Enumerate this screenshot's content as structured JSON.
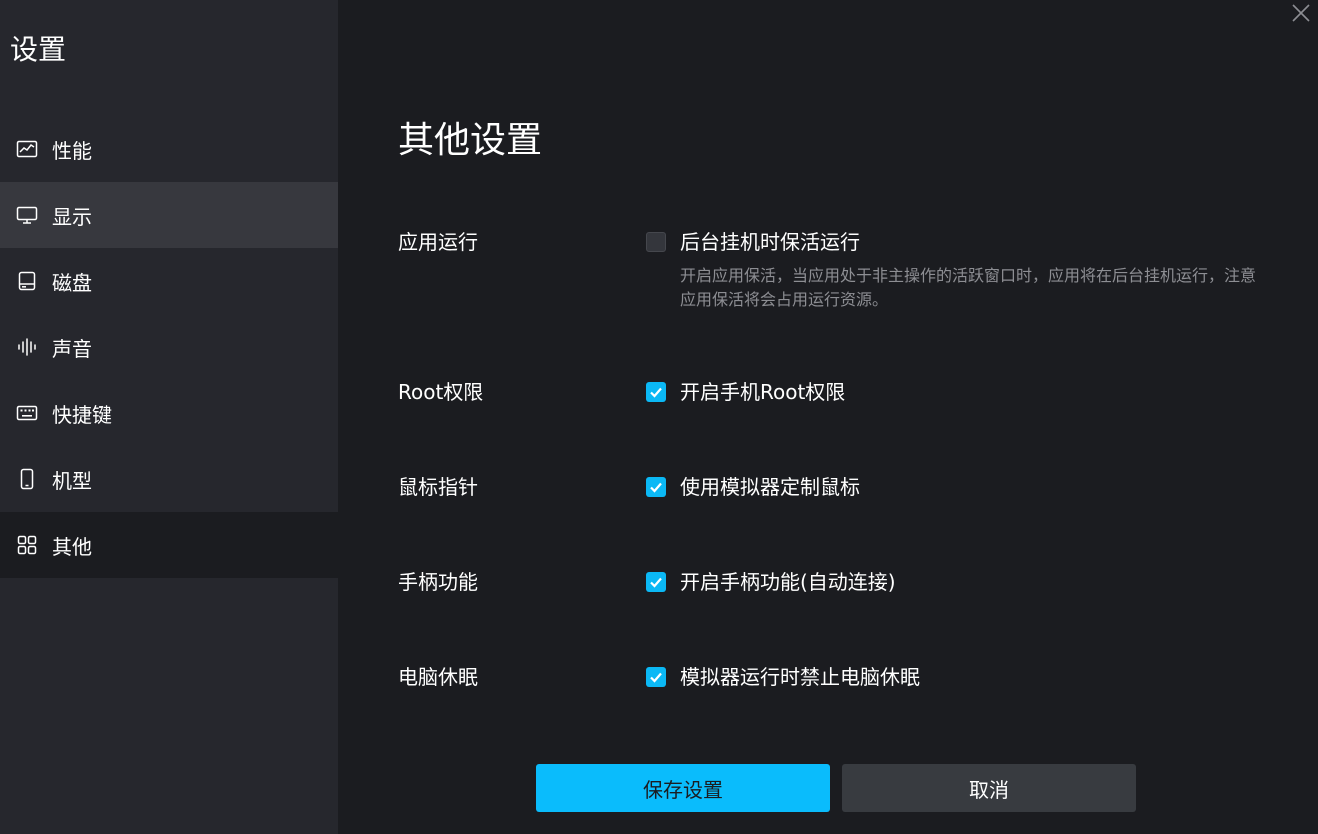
{
  "app": {
    "title": "设置"
  },
  "sidebar": {
    "items": [
      {
        "label": "性能",
        "icon": "chart-icon"
      },
      {
        "label": "显示",
        "icon": "monitor-icon"
      },
      {
        "label": "磁盘",
        "icon": "disk-icon"
      },
      {
        "label": "声音",
        "icon": "sound-wave-icon"
      },
      {
        "label": "快捷键",
        "icon": "keyboard-icon"
      },
      {
        "label": "机型",
        "icon": "phone-icon"
      },
      {
        "label": "其他",
        "icon": "grid-icon"
      }
    ],
    "hover_item": "显示",
    "active_item": "其他"
  },
  "main": {
    "title": "其他设置",
    "settings": [
      {
        "label": "应用运行",
        "option": "后台挂机时保活运行",
        "checked": false,
        "description": "开启应用保活，当应用处于非主操作的活跃窗口时，应用将在后台挂机运行，注意应用保活将会占用运行资源。"
      },
      {
        "label": "Root权限",
        "option": "开启手机Root权限",
        "checked": true
      },
      {
        "label": "鼠标指针",
        "option": "使用模拟器定制鼠标",
        "checked": true
      },
      {
        "label": "手柄功能",
        "option": "开启手柄功能(自动连接)",
        "checked": true
      },
      {
        "label": "电脑休眠",
        "option": "模拟器运行时禁止电脑休眠",
        "checked": true
      }
    ]
  },
  "buttons": {
    "save": "保存设置",
    "cancel": "取消"
  },
  "colors": {
    "accent": "#0abcfc",
    "sidebar_bg": "#26272d",
    "main_bg": "#1b1c20"
  }
}
